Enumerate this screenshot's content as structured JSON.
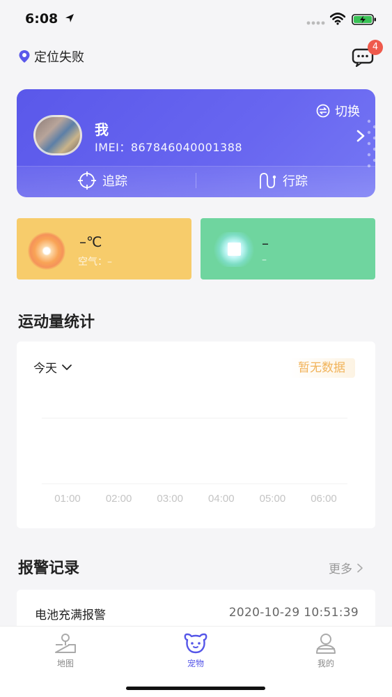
{
  "status_bar": {
    "time": "6:08"
  },
  "header": {
    "location_status": "定位失败",
    "message_badge": "4"
  },
  "device": {
    "name": "我",
    "imei": "IMEI：867846040001388",
    "switch_label": "切换",
    "track_label": "追踪",
    "trail_label": "行踪"
  },
  "weather": {
    "temperature": "–℃",
    "air": "空气：–"
  },
  "status_card": {
    "main": "–",
    "sub": "–"
  },
  "sport": {
    "title": "运动量统计",
    "day": "今天",
    "no_data": "暂无数据"
  },
  "chart_data": {
    "type": "line",
    "x": [
      "01:00",
      "02:00",
      "03:00",
      "04:00",
      "05:00",
      "06:00"
    ],
    "series": []
  },
  "alarm": {
    "title": "报警记录",
    "more": "更多",
    "items": [
      {
        "title": "电池充满报警",
        "time": "2020-10-29 10:51:39"
      }
    ]
  },
  "tabbar": {
    "map": "地图",
    "pet": "宠物",
    "mine": "我的"
  },
  "colors": {
    "accent": "#5a58ea",
    "weather_bg": "#f7cc6b",
    "status_bg": "#6fd59f",
    "badge": "#ef5a4c",
    "no_data": "#f1b35a"
  }
}
